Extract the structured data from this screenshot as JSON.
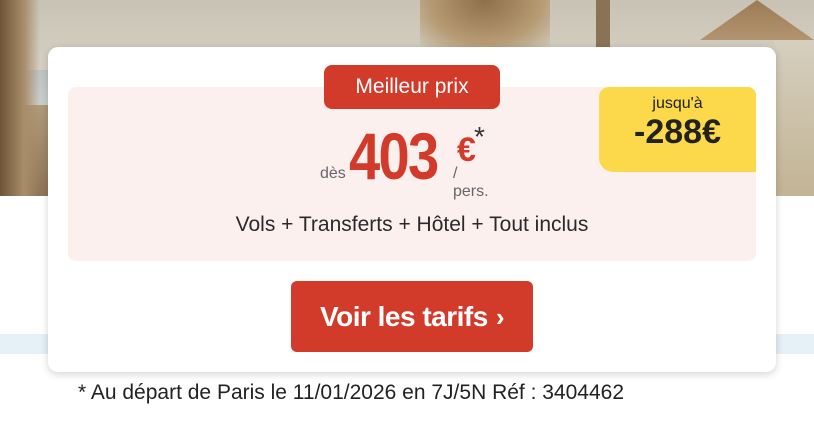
{
  "offer": {
    "badge": "Meilleur prix",
    "discount_prefix": "jusqu'à",
    "discount_value": "-288€",
    "price_prefix": "dès",
    "price_amount": "403",
    "price_currency": "€",
    "price_asterisk": "*",
    "price_suffix": "/ pers.",
    "package_label": "Vols + Transferts + Hôtel + Tout inclus",
    "cta_label": "Voir les tarifs",
    "cta_icon": "chevron-right-icon",
    "footnote": "* Au départ de Paris le 11/01/2026 en 7J/5N Réf : 3404462"
  },
  "colors": {
    "accent_red": "#d23a2a",
    "discount_yellow": "#fbd94a",
    "panel_pink": "#fcf0ef"
  }
}
